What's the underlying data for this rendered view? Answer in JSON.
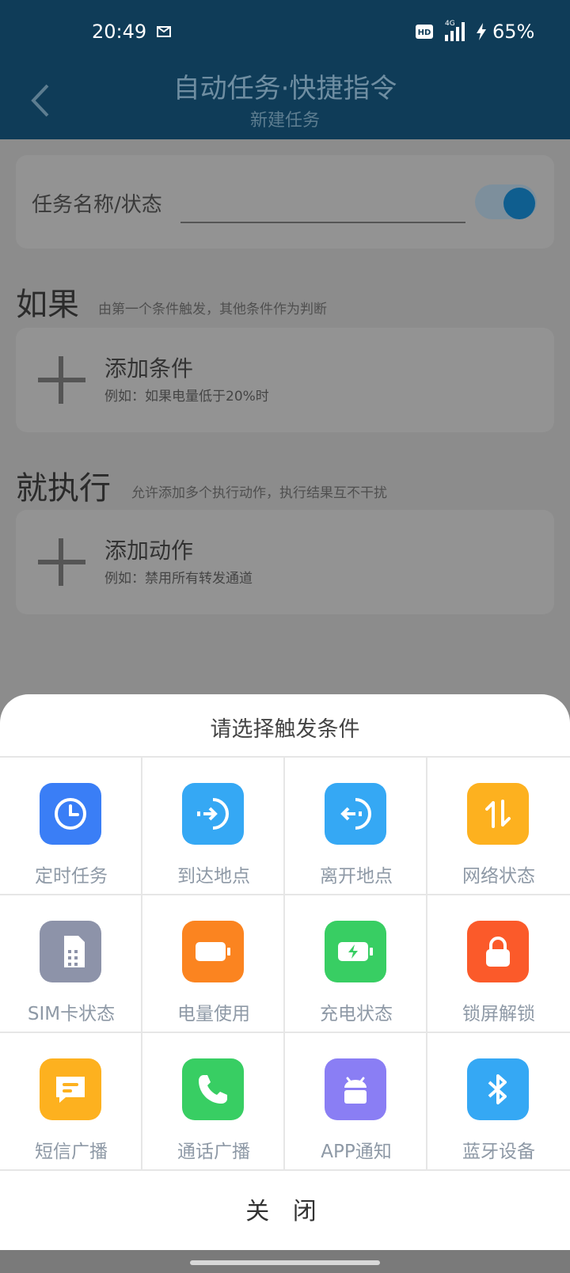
{
  "status_bar": {
    "time": "20:49",
    "battery": "65%",
    "hd": "HD",
    "network": "4G"
  },
  "header": {
    "title": "自动任务·快捷指令",
    "subtitle": "新建任务"
  },
  "task": {
    "name_label": "任务名称/状态",
    "enabled": true
  },
  "if_section": {
    "title": "如果",
    "desc": "由第一个条件触发，其他条件作为判断",
    "add_label": "添加条件",
    "example": "例如：如果电量低于20%时"
  },
  "then_section": {
    "title": "就执行",
    "desc": "允许添加多个执行动作，执行结果互不干扰",
    "add_label": "添加动作",
    "example": "例如：禁用所有转发通道"
  },
  "sheet": {
    "title": "请选择触发条件",
    "close_label": "关 闭",
    "options": [
      {
        "label": "定时任务",
        "icon": "clock-icon",
        "color": "#3a7ef6"
      },
      {
        "label": "到达地点",
        "icon": "arrive-location-icon",
        "color": "#35a8f4"
      },
      {
        "label": "离开地点",
        "icon": "leave-location-icon",
        "color": "#35a8f4"
      },
      {
        "label": "网络状态",
        "icon": "network-icon",
        "color": "#fdb11f"
      },
      {
        "label": "SIM卡状态",
        "icon": "sim-card-icon",
        "color": "#8d93a9"
      },
      {
        "label": "电量使用",
        "icon": "battery-icon",
        "color": "#fb8420"
      },
      {
        "label": "充电状态",
        "icon": "charging-icon",
        "color": "#38ce63"
      },
      {
        "label": "锁屏解锁",
        "icon": "lock-icon",
        "color": "#fb5a2a"
      },
      {
        "label": "短信广播",
        "icon": "sms-icon",
        "color": "#fdb11f"
      },
      {
        "label": "通话广播",
        "icon": "phone-icon",
        "color": "#38ce63"
      },
      {
        "label": "APP通知",
        "icon": "android-icon",
        "color": "#8a7ef4"
      },
      {
        "label": "蓝牙设备",
        "icon": "bluetooth-icon",
        "color": "#35a8f4"
      }
    ]
  }
}
